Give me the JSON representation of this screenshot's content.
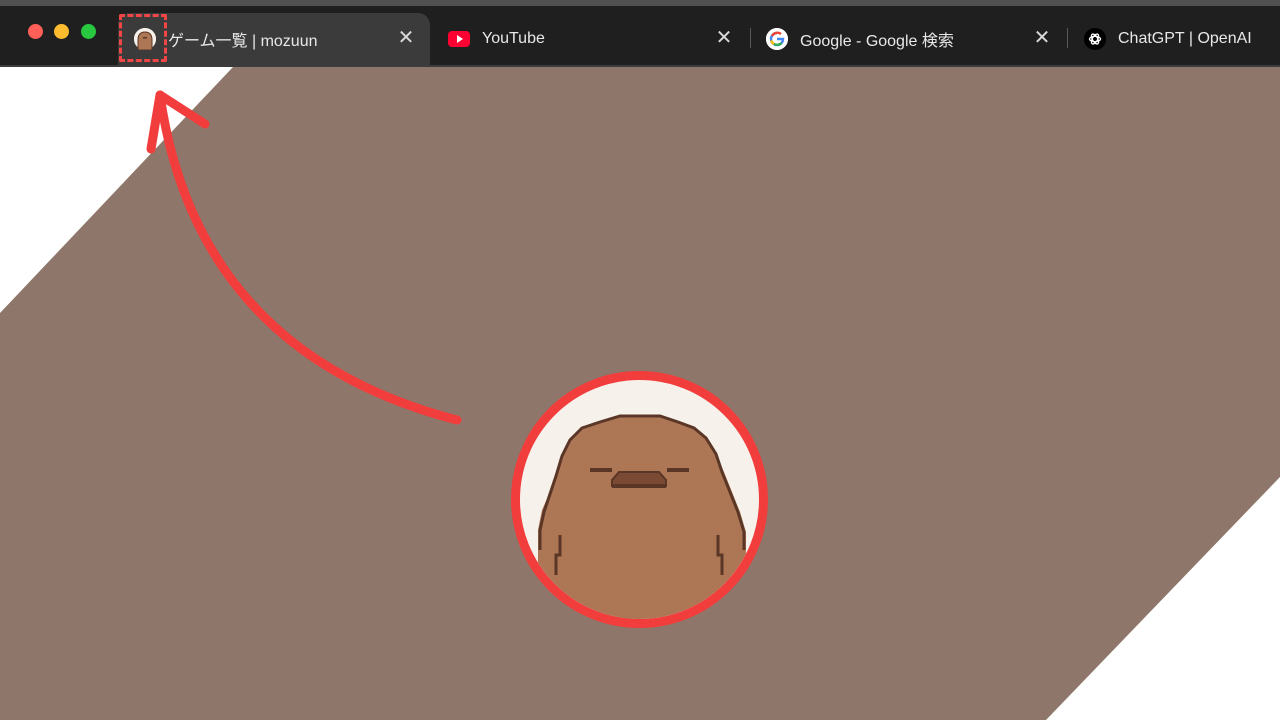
{
  "browser": {
    "tabs": [
      {
        "title": "ゲーム一覧 | mozuun",
        "favicon": "mole-character-icon",
        "active": true,
        "close_label": "✕"
      },
      {
        "title": "YouTube",
        "favicon": "youtube-icon",
        "active": false,
        "close_label": "✕"
      },
      {
        "title": "Google - Google 検索",
        "favicon": "google-icon",
        "active": false,
        "close_label": "✕"
      },
      {
        "title": "ChatGPT | OpenAI",
        "favicon": "openai-icon",
        "active": false
      }
    ]
  },
  "colors": {
    "background_band": "#8e776a",
    "highlight_red": "#f23d3d",
    "character_body": "#ad7655",
    "character_outline": "#5a3626",
    "avatar_bg": "#f6f1ea"
  }
}
